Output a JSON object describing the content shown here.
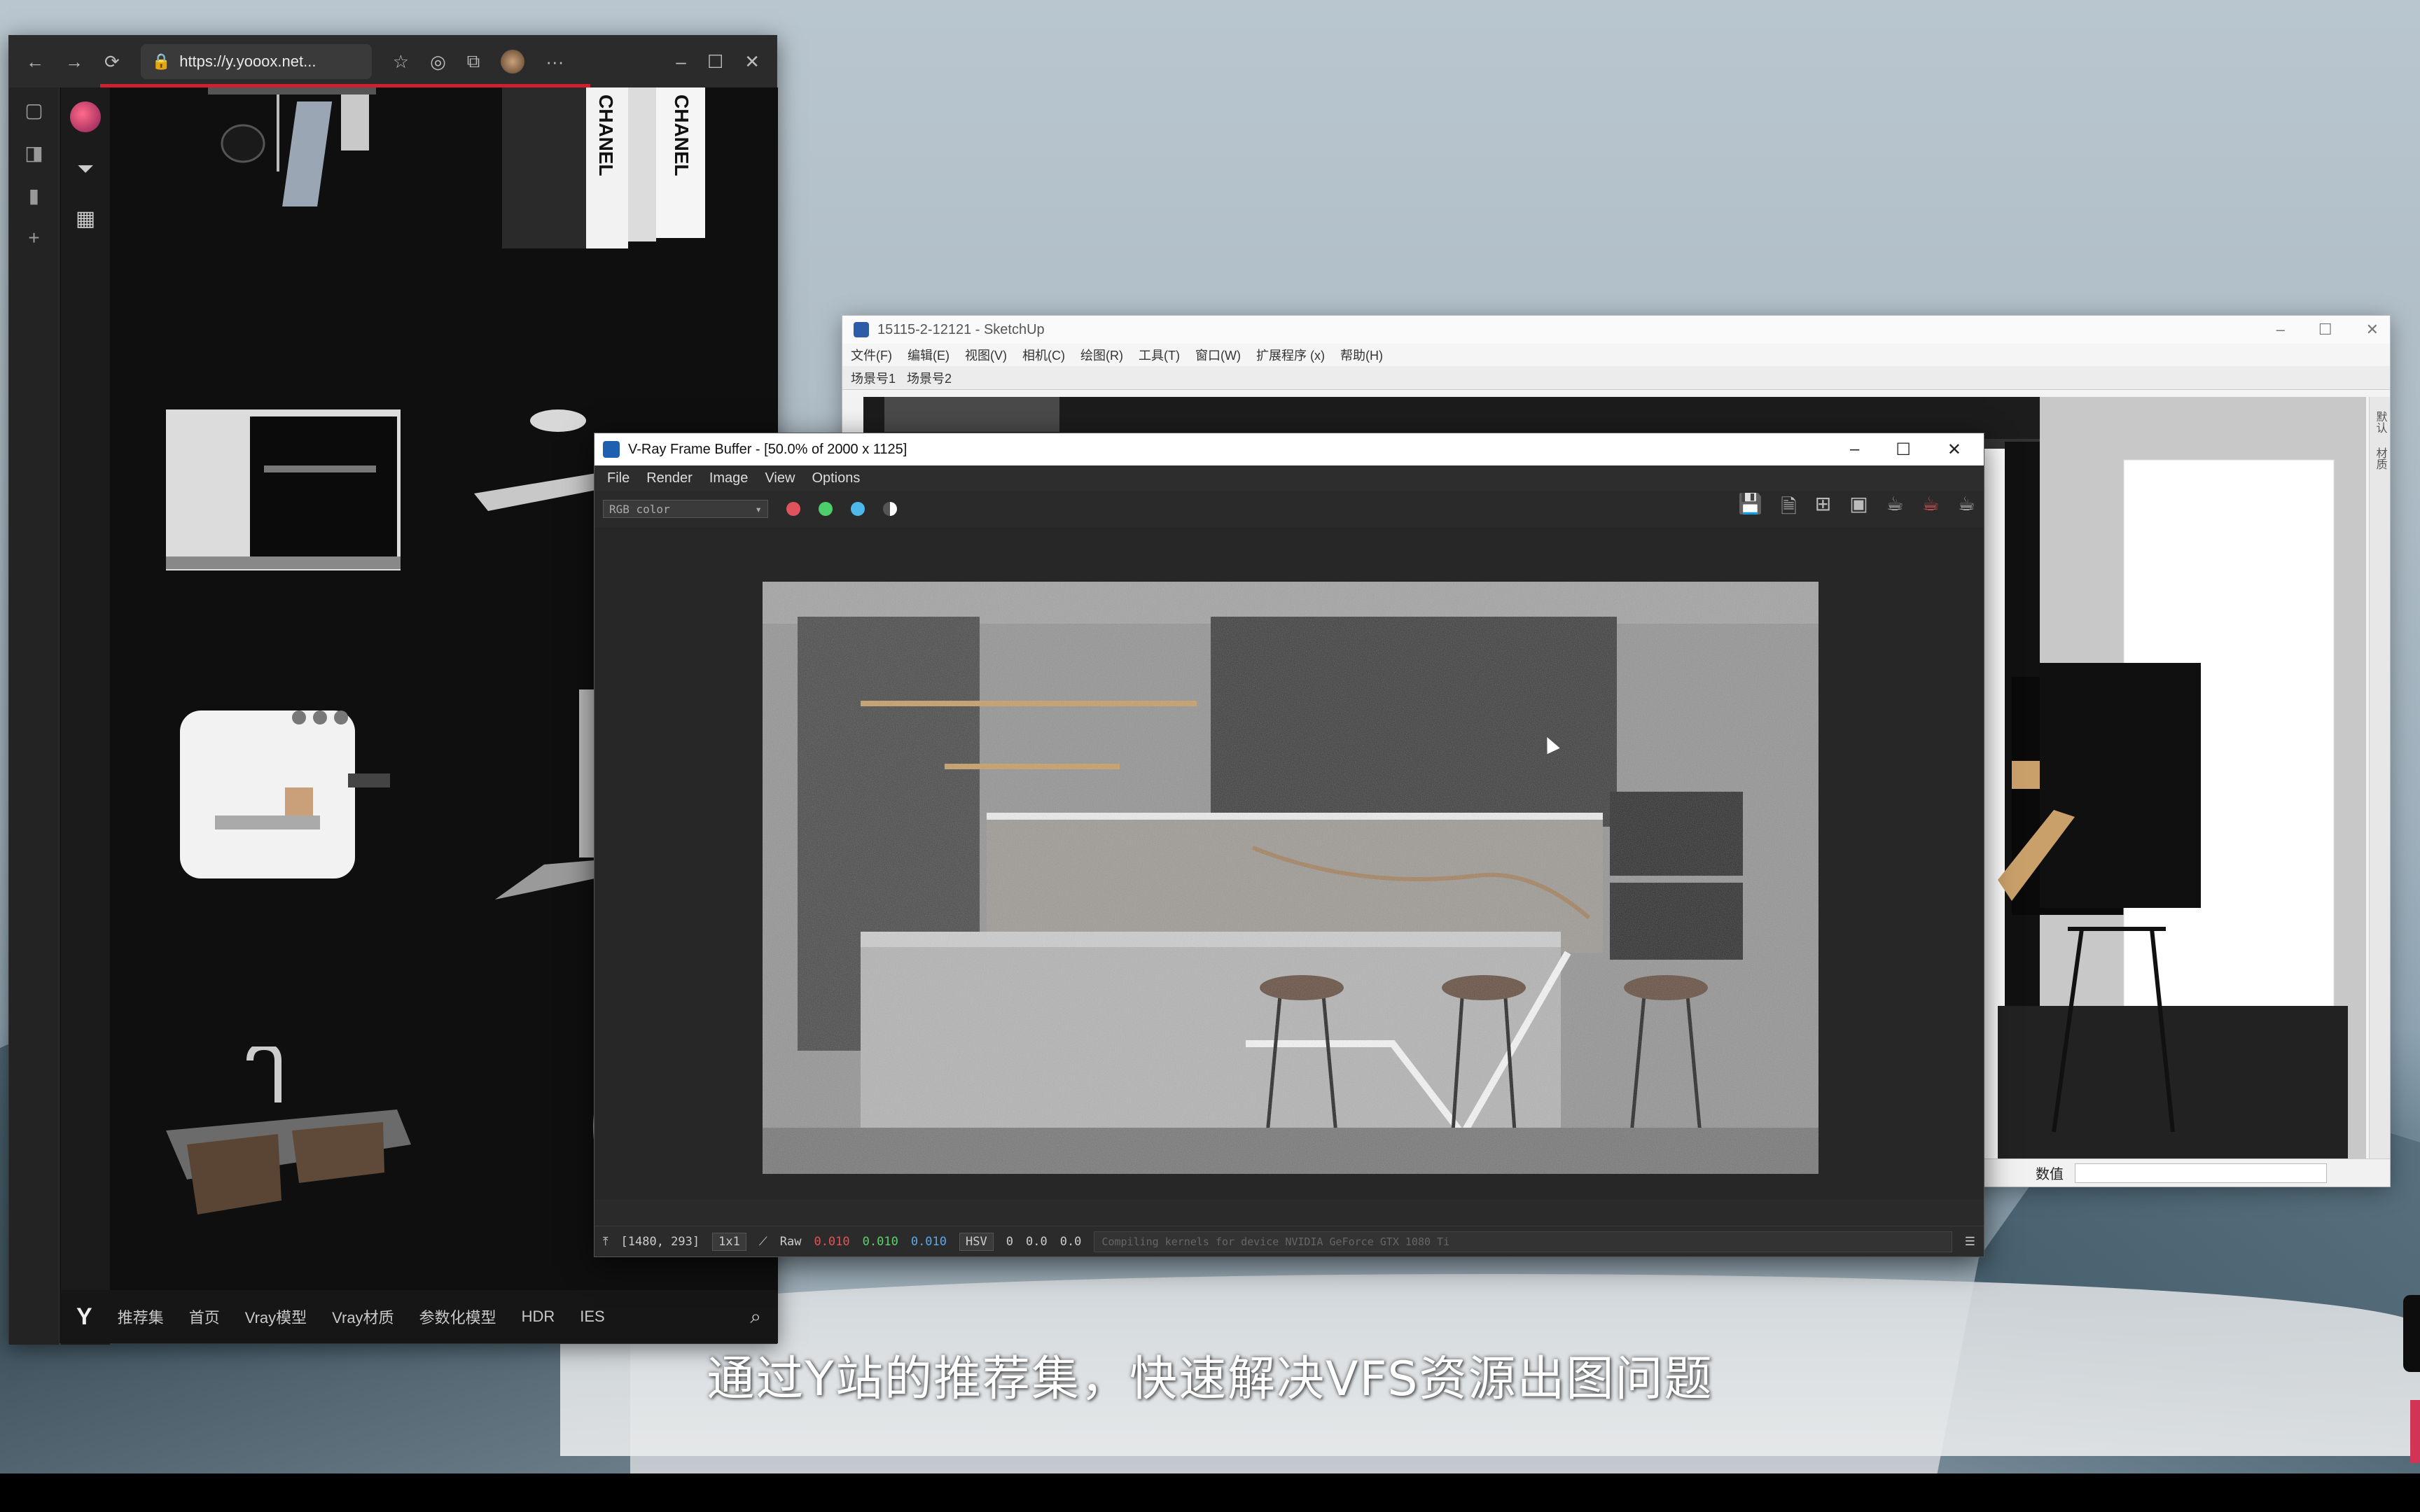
{
  "browser": {
    "address": "https://y.yooox.net...",
    "footer_logo": "Y",
    "footer_nav": [
      "推荐集",
      "首页",
      "Vray模型",
      "Vray材质",
      "参数化模型",
      "HDR",
      "IES"
    ],
    "product_labels": [
      "CHANEL",
      "CHANEL"
    ]
  },
  "sketchup": {
    "title": "15115-2-12121 - SketchUp",
    "menu": [
      "文件(F)",
      "编辑(E)",
      "视图(V)",
      "相机(C)",
      "绘图(R)",
      "工具(T)",
      "窗口(W)",
      "扩展程序 (x)",
      "帮助(H)"
    ],
    "tabs": [
      "场景号1",
      "场景号2"
    ],
    "status_label": "数值",
    "right_panel": [
      "默认",
      "材质"
    ]
  },
  "vfb": {
    "title": "V-Ray Frame Buffer - [50.0% of 2000 x 1125]",
    "menu": [
      "File",
      "Render",
      "Image",
      "View",
      "Options"
    ],
    "channel": "RGB color",
    "channel_colors": [
      "#e0535d",
      "#4ccf6a",
      "#4fb8ea"
    ],
    "status": {
      "coords": "[1480, 293]",
      "zoom": "1x1",
      "mode": "Raw",
      "r": "0.010",
      "g": "0.010",
      "b": "0.010",
      "colorspace": "HSV",
      "h": "0",
      "s": "0.0",
      "v": "0.0",
      "log": "Compiling kernels for device NVIDIA GeForce GTX 1080 Ti"
    }
  },
  "caption": "通过Y站的推荐集，快速解决VFS资源出图问题"
}
